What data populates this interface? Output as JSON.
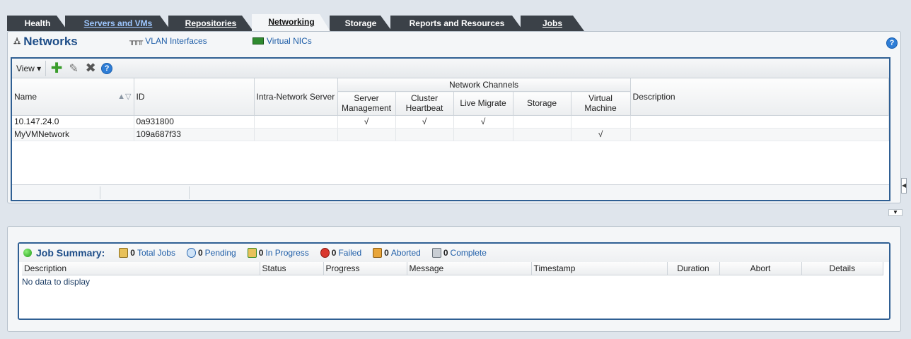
{
  "tabs": [
    {
      "label": "Health",
      "state": "normal"
    },
    {
      "label": "Servers and VMs",
      "state": "normal"
    },
    {
      "label": "Repositories",
      "state": "normal"
    },
    {
      "label": "Networking",
      "state": "active"
    },
    {
      "label": "Storage",
      "state": "normal"
    },
    {
      "label": "Reports and Resources",
      "state": "normal"
    },
    {
      "label": "Jobs",
      "state": "normal"
    }
  ],
  "subtabs": {
    "networks": "Networks",
    "vlan": "VLAN Interfaces",
    "vnics": "Virtual NICs"
  },
  "help_icon": "?",
  "toolbar": {
    "view_label": "View ▾",
    "icons": [
      "add-icon",
      "edit-icon",
      "delete-icon",
      "help-icon"
    ]
  },
  "grid": {
    "group_header": "Network Channels",
    "columns": {
      "name": "Name",
      "id": "ID",
      "intra": "Intra-Network Server",
      "server_mgmt": "Server Management",
      "cluster_hb": "Cluster Heartbeat",
      "live_migrate": "Live Migrate",
      "storage": "Storage",
      "vm": "Virtual Machine",
      "description": "Description"
    },
    "rows": [
      {
        "name": "10.147.24.0",
        "id": "0a931800",
        "intra": "",
        "server_mgmt": "√",
        "cluster_hb": "√",
        "live_migrate": "√",
        "storage": "",
        "vm": "",
        "description": ""
      },
      {
        "name": "MyVMNetwork",
        "id": "109a687f33",
        "intra": "",
        "server_mgmt": "",
        "cluster_hb": "",
        "live_migrate": "",
        "storage": "",
        "vm": "√",
        "description": ""
      }
    ]
  },
  "job_summary": {
    "title": "Job Summary:",
    "stats": {
      "total": {
        "count": "0",
        "label": "Total Jobs"
      },
      "pending": {
        "count": "0",
        "label": "Pending"
      },
      "in_progress": {
        "count": "0",
        "label": "In Progress"
      },
      "failed": {
        "count": "0",
        "label": "Failed"
      },
      "aborted": {
        "count": "0",
        "label": "Aborted"
      },
      "complete": {
        "count": "0",
        "label": "Complete"
      }
    },
    "columns": [
      "Description",
      "Status",
      "Progress",
      "Message",
      "Timestamp",
      "Duration",
      "Abort",
      "Details"
    ],
    "empty_text": "No data to display"
  },
  "colors": {
    "accent": "#2f5f93",
    "tab_dark": "#3b4148",
    "link": "#1f5ea8"
  }
}
